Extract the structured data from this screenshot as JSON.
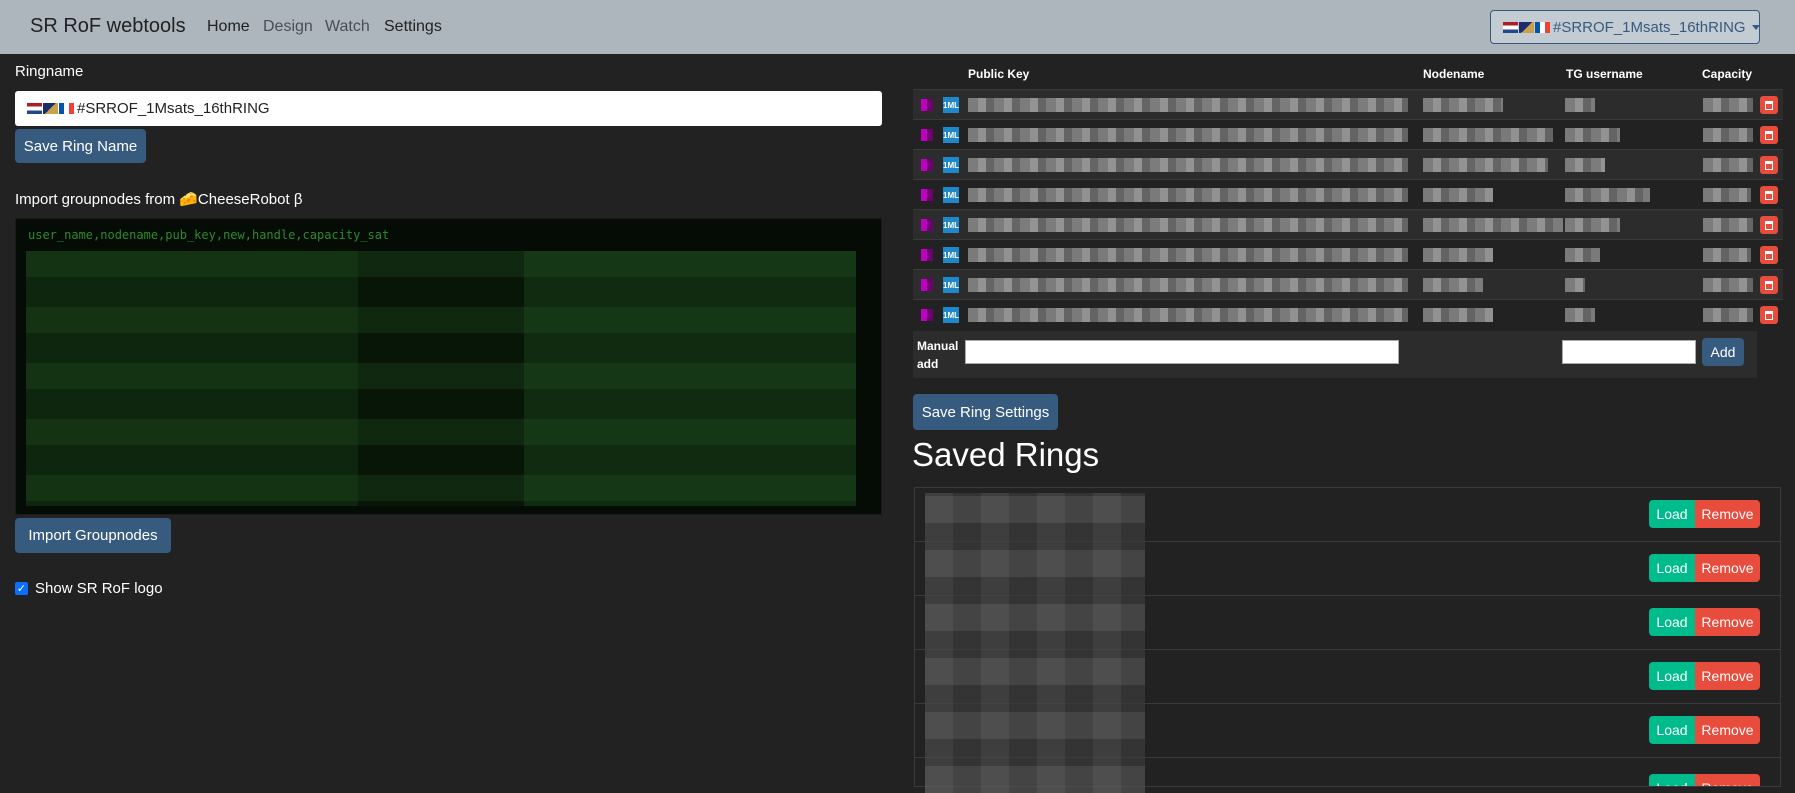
{
  "navbar": {
    "brand": "SR RoF webtools",
    "links": [
      "Home",
      "Design",
      "Watch",
      "Settings"
    ],
    "ring_selector": "#SRROF_1Msats_16thRING"
  },
  "left": {
    "ringname_label": "Ringname",
    "ringname_value": "#SRROF_1Msats_16thRING",
    "save_ring_name_button": "Save Ring Name",
    "import_label": "Import groupnodes from 🧀CheeseRobot β",
    "import_header": "user_name,nodename,pub_key,new,handle,capacity_sat",
    "import_button": "Import Groupnodes",
    "show_logo_label": "Show SR RoF logo",
    "show_logo_checked": true
  },
  "table": {
    "headers": [
      "Public Key",
      "Nodename",
      "TG username",
      "Capacity"
    ],
    "manual_add_label": "Manual add",
    "add_button": "Add",
    "save_settings_button": "Save Ring Settings",
    "icon_1ml": "1ML"
  },
  "saved": {
    "title": "Saved Rings",
    "load_label": "Load",
    "remove_label": "Remove"
  },
  "colors": {
    "navbar": "#adb5bd",
    "primary": "#375a7f",
    "success": "#00bc8c",
    "danger": "#e74c3c"
  }
}
